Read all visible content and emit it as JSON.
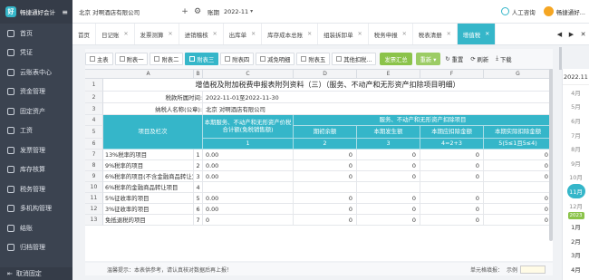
{
  "app": {
    "logo_text": "畅捷通好会计",
    "logo_mark": "好"
  },
  "sidebar": {
    "items": [
      {
        "label": "首页"
      },
      {
        "label": "凭证"
      },
      {
        "label": "云账表中心"
      },
      {
        "label": "资金管理"
      },
      {
        "label": "固定资产"
      },
      {
        "label": "工资"
      },
      {
        "label": "发票管理"
      },
      {
        "label": "库存核算"
      },
      {
        "label": "税务管理"
      },
      {
        "label": "多机构管理"
      },
      {
        "label": "结账"
      },
      {
        "label": "归档管理"
      }
    ],
    "footer": "取消固定"
  },
  "topbar": {
    "company": "北京 对啊酒店有限公司",
    "period_label": "账期",
    "period_value": "2022-11",
    "service": "人工咨询",
    "user": "畅捷通好..."
  },
  "tabs": [
    {
      "label": "首页",
      "closable": false
    },
    {
      "label": "日记账",
      "closable": true
    },
    {
      "label": "发票测算",
      "closable": true
    },
    {
      "label": "进销稽核",
      "closable": true
    },
    {
      "label": "出库单",
      "closable": true
    },
    {
      "label": "库存成本总账",
      "closable": true
    },
    {
      "label": "组装拆卸单",
      "closable": true
    },
    {
      "label": "税务申报",
      "closable": true
    },
    {
      "label": "税表清册",
      "closable": true
    },
    {
      "label": "增值税",
      "closable": true,
      "active": true
    }
  ],
  "toolbar": {
    "sheets": [
      "主表",
      "附表一",
      "附表二",
      "附表三",
      "附表四",
      "减免明细",
      "附表五",
      "其他扣税..."
    ],
    "active_sheet": 3,
    "btn_summary": "发票汇总",
    "btn_reset": "重新",
    "btn_refresh": "重置",
    "btn_fresh": "刷新",
    "btn_download": "下载"
  },
  "sheet": {
    "col_letters": [
      "A",
      "B",
      "C",
      "D",
      "E",
      "F",
      "G"
    ],
    "title": "增值税及附加税费申报表附列资料（三）（服务、不动产和无形资产扣除项目明细）",
    "period_label": "税款所属时间:",
    "period_value": "2022-11-01至2022-11-30",
    "taxpayer_label": "纳税人名称(公章):",
    "taxpayer_value": "北京 对啊酒店有限公司",
    "hdr_item": "项目及栏次",
    "hdr_c": "本期服务、不动产和无形资产价税合计额(免税销售额)",
    "hdr_deduct": "服务、不动产和无形资产扣除项目",
    "hdr_d": "期初余额",
    "hdr_e": "本期发生额",
    "hdr_f": "本期应扣除金额",
    "hdr_g": "本期实际扣除金额",
    "hdr_c_num": "1",
    "hdr_d_num": "2",
    "hdr_e_num": "3",
    "hdr_f_num": "4=2+3",
    "hdr_g_num": "5(5≤1且5≤4)",
    "rows": [
      {
        "rn": "7",
        "label": "13%税率的项目",
        "b": "1",
        "c": "0.00",
        "d": "0",
        "e": "0",
        "f": "0",
        "g": "0"
      },
      {
        "rn": "8",
        "label": "9%税率的项目",
        "b": "2",
        "c": "0.00",
        "d": "0",
        "e": "0",
        "f": "0",
        "g": "0"
      },
      {
        "rn": "9",
        "label": "6%税率的项目(不含金融商品转让)",
        "b": "3",
        "c": "0.00",
        "d": "0",
        "e": "0",
        "f": "0",
        "g": "0"
      },
      {
        "rn": "10",
        "label": "6%税率的金融商品转让项目",
        "b": "4",
        "c": "",
        "d": "",
        "e": "",
        "f": "",
        "g": ""
      },
      {
        "rn": "11",
        "label": "5%征收率的项目",
        "b": "5",
        "c": "0.00",
        "d": "0",
        "e": "0",
        "f": "0",
        "g": "0"
      },
      {
        "rn": "12",
        "label": "3%征收率的项目",
        "b": "6",
        "c": "0.00",
        "d": "0",
        "e": "0",
        "f": "0",
        "g": "0"
      },
      {
        "rn": "13",
        "label": "免抵退税的项目",
        "b": "7",
        "c": "0",
        "d": "0",
        "e": "0",
        "f": "0",
        "g": "0"
      }
    ]
  },
  "footer": {
    "tip": "温馨提示：本表供参考，请认真核对数据后再上报！",
    "cell_fill": "单元格填报：",
    "sample": "示例"
  },
  "right_panel": {
    "year": "2022.11",
    "months": [
      "4月",
      "5月",
      "6月",
      "7月",
      "8月",
      "9月",
      "10月",
      "11月",
      "12月"
    ],
    "current": "11月",
    "year_tag": "2023",
    "months_next": [
      "1月",
      "2月",
      "3月",
      "4月"
    ]
  },
  "colors": {
    "accent": "#35b6c9",
    "green": "#8bc34a",
    "sidebar": "#3b4350"
  }
}
